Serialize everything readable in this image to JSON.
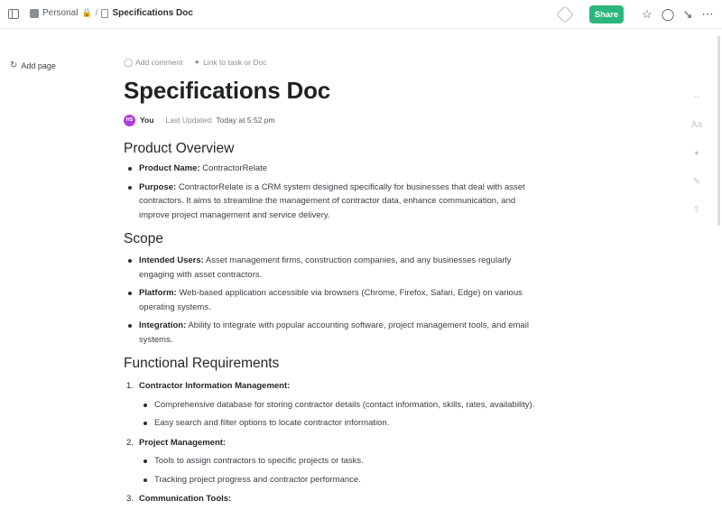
{
  "topbar": {
    "breadcrumb": [
      "Personal",
      "Specifications Doc"
    ],
    "separator": "/",
    "share_label": "Share"
  },
  "sidebar": {
    "add_page_label": "Add page"
  },
  "doc": {
    "actions": {
      "add_comment": "Add comment",
      "link_task": "Link to task or Doc"
    },
    "title": "Specifications Doc",
    "author": {
      "initials": "HS",
      "name": "You",
      "avatar_color": "#b03bdb"
    },
    "last_updated_label": "Last Updated:",
    "last_updated_value": "Today at 5:52 pm",
    "sections": {
      "overview": {
        "heading": "Product Overview",
        "items": [
          {
            "label": "Product Name:",
            "text": " ContractorRelate"
          },
          {
            "label": "Purpose:",
            "text": " ContractorRelate is a CRM system designed specifically for businesses that deal with asset contractors. It aims to streamline the management of contractor data, enhance communication, and improve project management and service delivery."
          }
        ]
      },
      "scope": {
        "heading": "Scope",
        "items": [
          {
            "label": "Intended Users:",
            "text": " Asset management firms, construction companies, and any businesses regularly engaging with asset contractors."
          },
          {
            "label": "Platform:",
            "text": " Web-based application accessible via browsers (Chrome, Firefox, Safari, Edge) on various operating systems."
          },
          {
            "label": "Integration:",
            "text": " Ability to integrate with popular accounting software, project management tools, and email systems."
          }
        ]
      },
      "functional": {
        "heading": "Functional Requirements",
        "items": [
          {
            "num": "1.",
            "label": "Contractor Information Management:",
            "subs": [
              "Comprehensive database for storing contractor details (contact information, skills, rates, availability).",
              "Easy search and filter options to locate contractor information."
            ]
          },
          {
            "num": "2.",
            "label": "Project Management:",
            "subs": [
              "Tools to assign contractors to specific projects or tasks.",
              "Tracking project progress and contractor performance."
            ]
          },
          {
            "num": "3.",
            "label": "Communication Tools:"
          }
        ]
      }
    }
  },
  "colors": {
    "share_button": "#2cb67d",
    "avatar": "#b03bdb"
  }
}
